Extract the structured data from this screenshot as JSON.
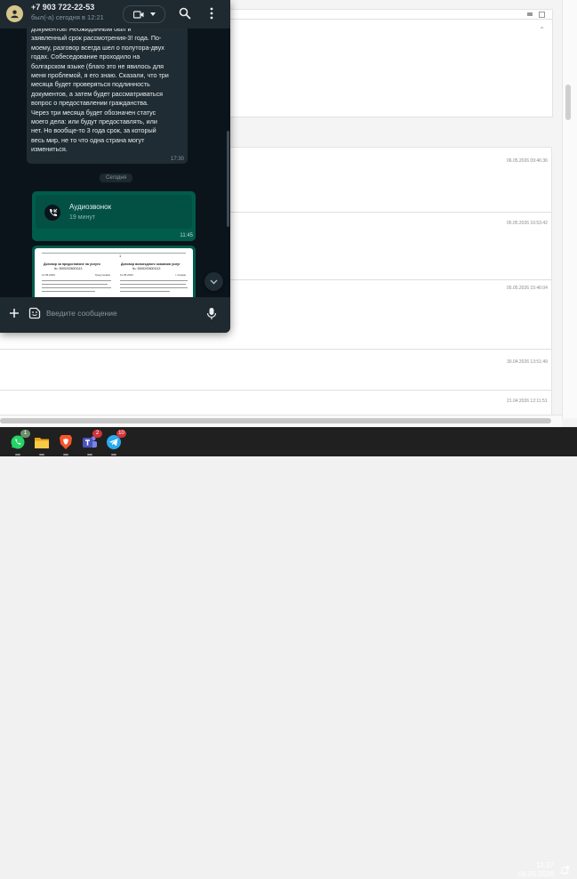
{
  "contact": {
    "name": "+7 903 722-22-53",
    "status": "был(-а) сегодня в 12:21"
  },
  "messages": [
    {
      "text": "документов! Неожиданным был и\nзаявленный срок рассмотрения-3! года. По-\nмоему, разговор всегда шел о полутора-двух\nгодах. Собеседование проходило на\nболгарском языке (благо это не явилось для\nменя проблемой, я его знаю. Сказали, что три\nмесяца будет проверяться подлинность\nдокументов, а затем будет рассматриваться\nвопрос о предоставлении гражданства.\nЧерез три месяца будет обозначен статус\nмоего дела: или будут предоставлять, или\nнет. Но вообще-то 3 года срок, за который\nвесь мир, не то что одна страна могут\nизмениться.",
      "time": "17:30"
    }
  ],
  "day_separator": "Сегодня",
  "call": {
    "title": "Аудиозвонок",
    "duration": "19 минут",
    "time": "11:45"
  },
  "document_preview": {
    "number": "1",
    "left_title": "Договор за предоставяне на услуги",
    "left_number": "№: 30052026001113",
    "left_date": "11.05.2023",
    "left_city": "Град София",
    "right_title": "Договор возмездного оказания услуг",
    "right_number": "№: 30052026001113",
    "right_date": "11.05.2023",
    "right_city": "г. София"
  },
  "composer": {
    "placeholder": "Введите сообщение"
  },
  "background_page": {
    "timestamps": [
      "06.05.2026 09:46:36",
      "05.05.2026 16:53:42",
      "05.05.2026 15:46:04",
      "30.04.2026 13:51:49",
      "21.04.2026 12:11:51"
    ]
  },
  "taskbar": {
    "apps": [
      {
        "name": "WhatsApp",
        "icon": "whatsapp-icon",
        "badge": "1"
      },
      {
        "name": "File Explorer",
        "icon": "folder-icon",
        "badge": ""
      },
      {
        "name": "Brave",
        "icon": "brave-icon",
        "badge": ""
      },
      {
        "name": "Teams",
        "icon": "teams-icon",
        "badge": "2"
      },
      {
        "name": "Telegram",
        "icon": "telegram-icon",
        "badge": "10"
      }
    ],
    "time": "12:37",
    "date": "06.05.2026"
  },
  "colors": {
    "header": "#1f2a30",
    "chat_bg": "#0b141a",
    "incoming_bubble": "#202c33",
    "outgoing_bubble": "#005c4b",
    "taskbar": "#202020"
  }
}
